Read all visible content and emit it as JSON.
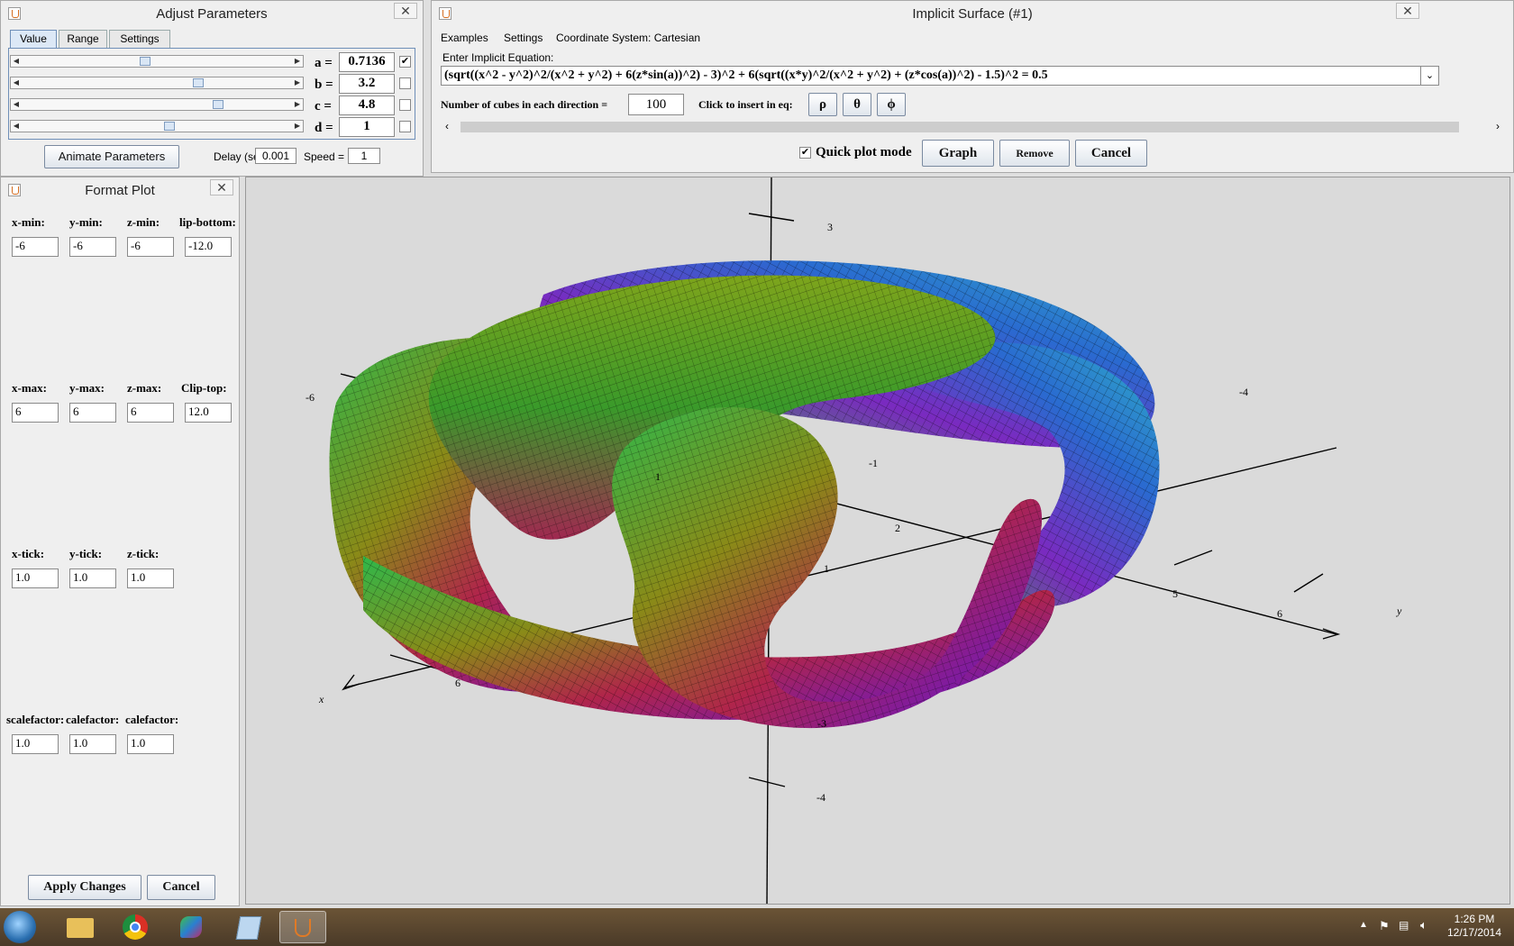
{
  "adjust": {
    "title": "Adjust Parameters",
    "close": "✕",
    "tabs": [
      "Value",
      "Range",
      "Settings"
    ],
    "params": [
      {
        "name": "a =",
        "value": "0.7136",
        "checked": true,
        "level": 0.41
      },
      {
        "name": "b =",
        "value": "3.2",
        "checked": false,
        "level": 0.62
      },
      {
        "name": "c =",
        "value": "4.8",
        "checked": false,
        "level": 0.69
      },
      {
        "name": "d =",
        "value": "1",
        "checked": false,
        "level": 0.52
      }
    ],
    "animate_label": "Animate Parameters",
    "delay_label": "Delay (sec) =",
    "delay_value": "0.001",
    "speed_label": "Speed =",
    "speed_value": "1"
  },
  "implicit": {
    "title": "Implicit Surface (#1)",
    "close": "✕",
    "menu": [
      "Examples",
      "Settings",
      "Coordinate System: Cartesian"
    ],
    "enter_label": "Enter Implicit Equation:",
    "equation": "(sqrt((x^2 - y^2)^2/(x^2 + y^2) + 6(z*sin(a))^2) - 3)^2 + 6(sqrt((x*y)^2/(x^2 + y^2) + (z*cos(a))^2) - 1.5)^2 = 0.5",
    "cubes_label": "Number of cubes in each direction =",
    "cubes_value": "100",
    "insert_label": "Click to insert in eq:",
    "insert_symbols": [
      "ρ",
      "θ",
      "ϕ"
    ],
    "quick_label": "Quick plot mode",
    "quick_checked": true,
    "graph_label": "Graph",
    "remove_label": "Remove",
    "cancel_label": "Cancel"
  },
  "format": {
    "title": "Format Plot",
    "close": "✕",
    "rows": [
      {
        "labels": [
          "x-min:",
          "y-min:",
          "z-min:",
          "lip-bottom:"
        ],
        "values": [
          "-6",
          "-6",
          "-6",
          "-12.0"
        ]
      },
      {
        "labels": [
          "x-max:",
          "y-max:",
          "z-max:",
          "Clip-top:"
        ],
        "values": [
          "6",
          "6",
          "6",
          "12.0"
        ]
      },
      {
        "labels": [
          "x-tick:",
          "y-tick:",
          "z-tick:"
        ],
        "values": [
          "1.0",
          "1.0",
          "1.0"
        ]
      },
      {
        "labels": [
          "scalefactor:",
          "calefactor:",
          "calefactor:"
        ],
        "values": [
          "1.0",
          "1.0",
          "1.0"
        ]
      }
    ],
    "apply_label": "Apply Changes",
    "cancel_label": "Cancel"
  },
  "plot": {
    "axis_labels": [
      "3",
      "-6",
      "-4",
      "-1",
      "1",
      "2",
      "1",
      "5",
      "6",
      "y",
      "6",
      "x",
      "-3",
      "-4"
    ]
  },
  "taskbar": {
    "time": "1:26 PM",
    "date": "12/17/2014",
    "items": [
      "start-orb",
      "file-explorer",
      "chrome",
      "app-3d",
      "notepad",
      "java"
    ]
  },
  "colors": {
    "accent": "#3c6db4",
    "taskbar": "#5a452e"
  }
}
